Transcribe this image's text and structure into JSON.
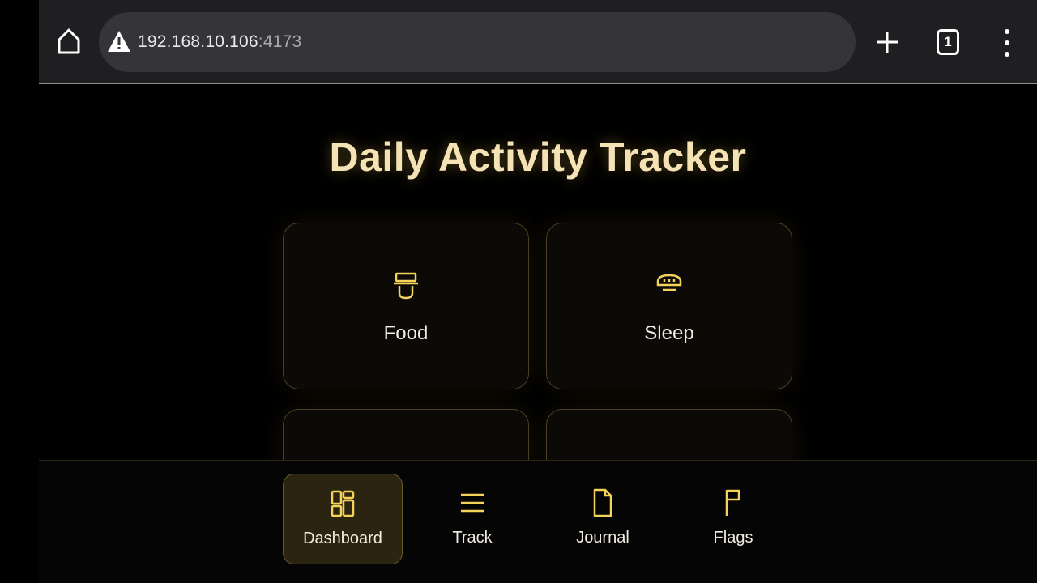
{
  "browser": {
    "url_host": "192.168.10.106",
    "url_port": ":4173",
    "tab_count": "1",
    "icons": {
      "home": "home-icon",
      "warning": "warning-icon",
      "new_tab": "plus-icon",
      "tabs": "tab-count-icon",
      "menu": "more-vertical-icon"
    }
  },
  "page": {
    "title": "Daily Activity Tracker",
    "cards": [
      {
        "label": "Food",
        "icon": "food-icon"
      },
      {
        "label": "Sleep",
        "icon": "sleep-icon"
      },
      {
        "label": "",
        "icon": "activity-icon"
      },
      {
        "label": "",
        "icon": "check-icon"
      }
    ]
  },
  "bottom_nav": {
    "items": [
      {
        "label": "Dashboard",
        "icon": "dashboard-icon",
        "active": true
      },
      {
        "label": "Track",
        "icon": "list-icon",
        "active": false
      },
      {
        "label": "Journal",
        "icon": "document-icon",
        "active": false
      },
      {
        "label": "Flags",
        "icon": "flag-icon",
        "active": false
      }
    ]
  },
  "colors": {
    "accent": "#f5d35a",
    "title": "#f5e2b5",
    "background": "#000000",
    "chrome": "#1f1f22",
    "omnibox": "#353539"
  }
}
